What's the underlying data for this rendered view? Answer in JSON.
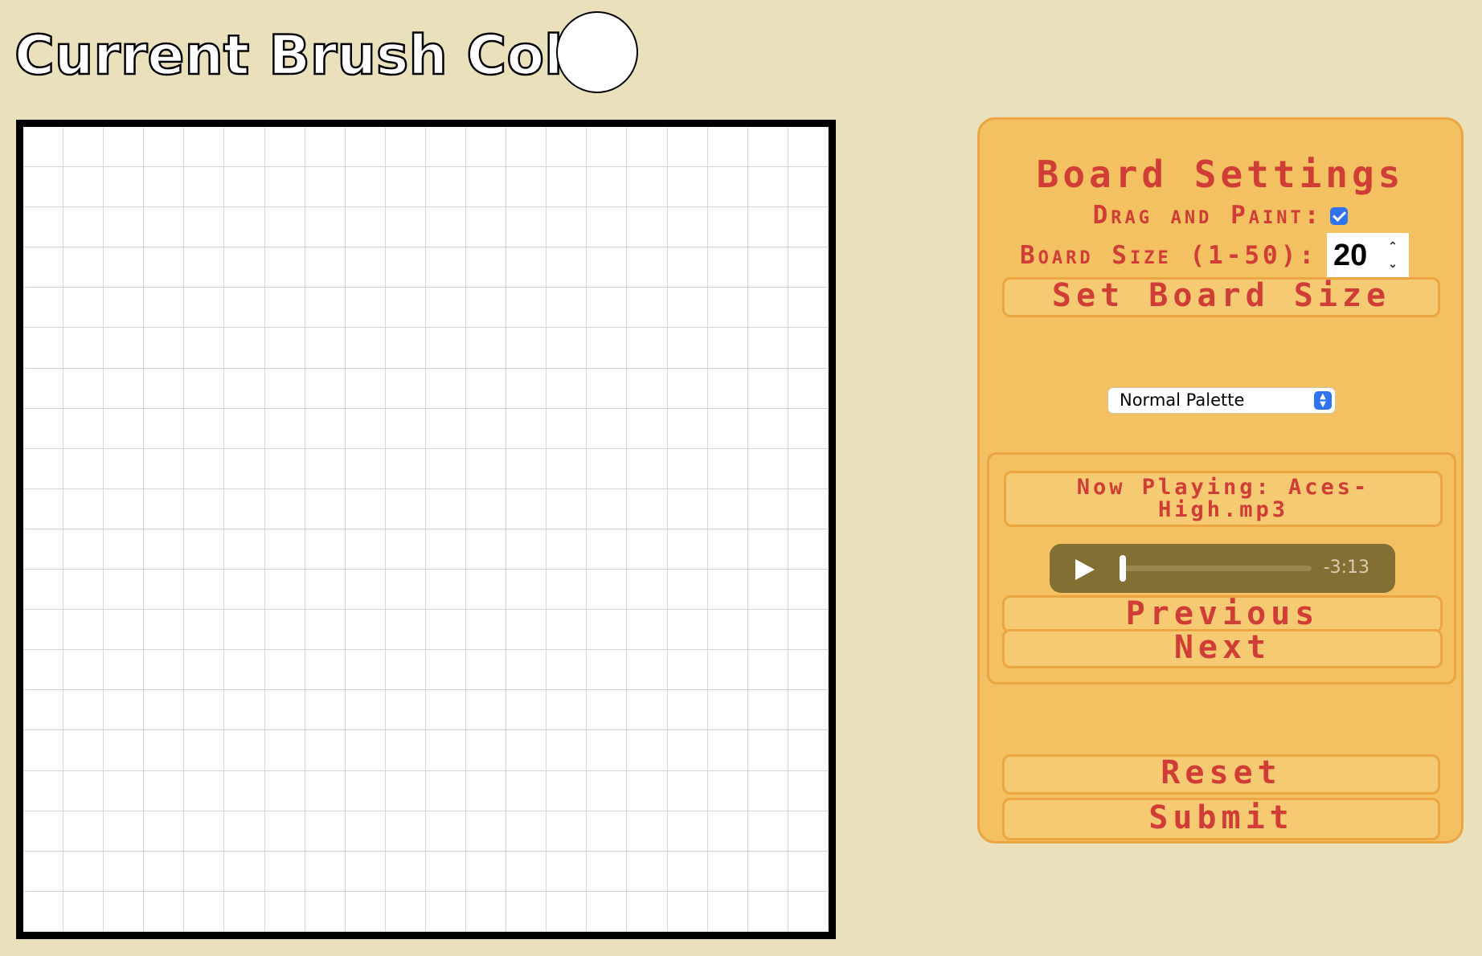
{
  "header": {
    "title": "Current Brush Color",
    "brush_color": "#ffffff"
  },
  "board": {
    "rows": 20,
    "columns": 20,
    "background": "#ffffff",
    "grid_line_color": "#d6d6d6"
  },
  "settings": {
    "title": "Board Settings",
    "drag_label": "Drag and Paint:",
    "drag_checked": true,
    "size_label": "Board Size (1-50):",
    "size_value": "20",
    "set_size_label": "Set Board Size",
    "palette_selected": "Normal Palette"
  },
  "music": {
    "now_playing": "Now Playing: Aces-High.mp3",
    "time_remaining": "-3:13",
    "progress": 0,
    "previous_label": "Previous",
    "next_label": "Next"
  },
  "actions": {
    "reset_label": "Reset",
    "submit_label": "Submit"
  },
  "colors": {
    "page_background": "#eae1bc",
    "panel_background": "#f3c161",
    "panel_border": "#eba542",
    "accent_text": "#cf3d36",
    "audio_background": "#836e34"
  }
}
